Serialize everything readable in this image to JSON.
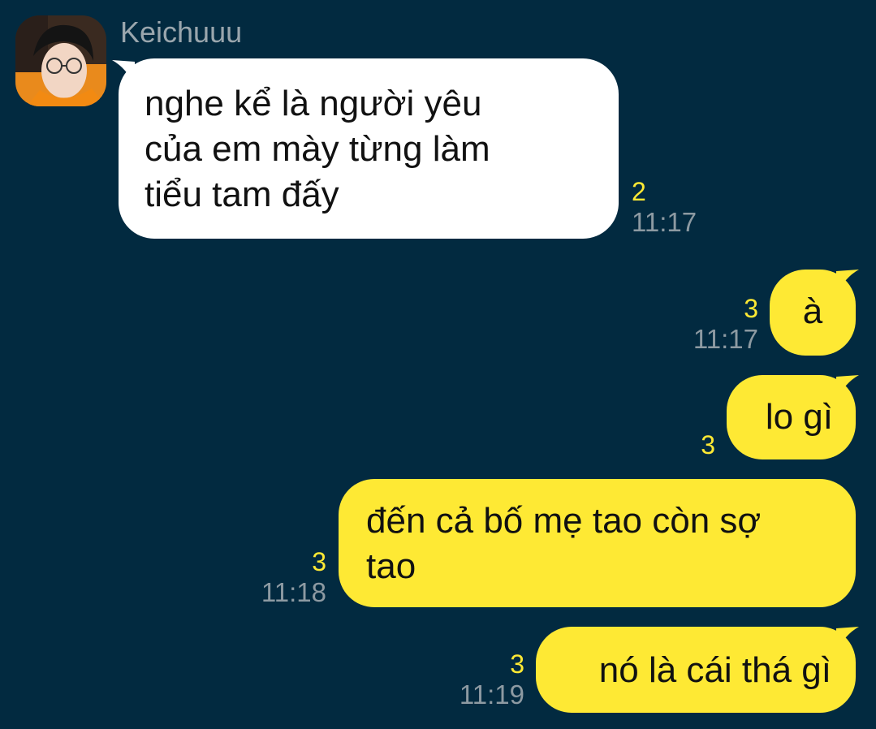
{
  "sender": {
    "name": "Keichuuu"
  },
  "colors": {
    "background": "#022a40",
    "incoming_bubble": "#ffffff",
    "outgoing_bubble": "#fee934",
    "unread_count": "#fee934",
    "timestamp": "#8d9aa2"
  },
  "messages": [
    {
      "direction": "incoming",
      "lines": [
        "nghe kể là người yêu",
        "của em mày từng làm",
        "tiểu tam đấy"
      ],
      "unread": "2",
      "time": "11:17"
    },
    {
      "direction": "outgoing",
      "lines": [
        "à"
      ],
      "unread": "3",
      "time": "11:17"
    },
    {
      "direction": "outgoing",
      "lines": [
        "lo gì"
      ],
      "unread": "3",
      "time": ""
    },
    {
      "direction": "outgoing",
      "lines": [
        "đến cả bố mẹ tao còn sợ",
        "tao"
      ],
      "unread": "3",
      "time": "11:18"
    },
    {
      "direction": "outgoing",
      "lines": [
        "nó là cái thá gì"
      ],
      "unread": "3",
      "time": "11:19"
    }
  ]
}
